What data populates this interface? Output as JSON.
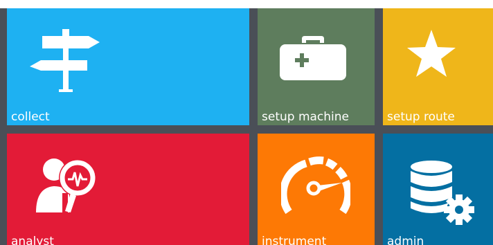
{
  "colors": {
    "collect": "#1eb1f2",
    "setup_machine": "#5e7d5d",
    "setup_route": "#efb61a",
    "analyst": "#e31b37",
    "instrument": "#fd7905",
    "admin": "#046fa2",
    "gap": "#4a4f57",
    "icon": "#ffffff"
  },
  "tiles": {
    "collect": {
      "label": "collect",
      "icon": "signpost-icon"
    },
    "setup_machine": {
      "label": "setup machine",
      "icon": "medical-kit-icon"
    },
    "setup_route": {
      "label": "setup route",
      "icon": "star-icon"
    },
    "analyst": {
      "label": "analyst",
      "icon": "analyst-magnifier-icon"
    },
    "instrument": {
      "label": "instrument",
      "icon": "gauge-icon"
    },
    "admin": {
      "label": "admin",
      "icon": "database-gear-icon"
    }
  }
}
